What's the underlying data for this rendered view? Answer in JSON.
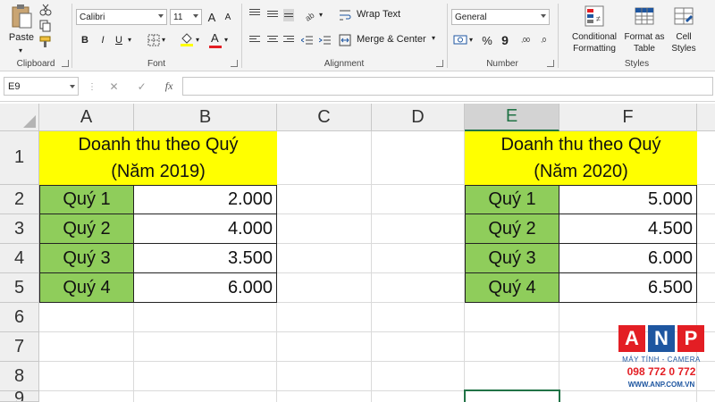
{
  "ribbon": {
    "clipboard": {
      "paste_label": "Paste",
      "group_label": "Clipboard"
    },
    "font": {
      "font_name": "Calibri",
      "font_size": "11",
      "grow_label": "A",
      "shrink_label": "A",
      "bold": "B",
      "italic": "I",
      "underline": "U",
      "font_color_label": "A",
      "group_label": "Font"
    },
    "alignment": {
      "wrap_label": "Wrap Text",
      "merge_label": "Merge & Center",
      "group_label": "Alignment"
    },
    "number": {
      "format": "General",
      "percent": "%",
      "comma": "9",
      "inc_decimal": ",00",
      "dec_decimal": ",0",
      "group_label": "Number"
    },
    "styles": {
      "cond_line1": "Conditional",
      "cond_line2": "Formatting",
      "table_line1": "Format as",
      "table_line2": "Table",
      "cell_line1": "Cell",
      "cell_line2": "Styles",
      "group_label": "Styles"
    }
  },
  "formula_bar": {
    "name_box": "E9",
    "cancel": "✕",
    "enter": "✓",
    "fx": "fx",
    "value": ""
  },
  "grid": {
    "columns": [
      "A",
      "B",
      "C",
      "D",
      "E",
      "F"
    ],
    "selected_column": "E",
    "rows": [
      "1",
      "2",
      "3",
      "4",
      "5",
      "6",
      "7",
      "8",
      "9"
    ]
  },
  "table_2019": {
    "title_line1": "Doanh thu theo Quý",
    "title_line2": "(Năm 2019)",
    "rows": [
      {
        "label": "Quý 1",
        "value": "2.000"
      },
      {
        "label": "Quý 2",
        "value": "4.000"
      },
      {
        "label": "Quý 3",
        "value": "3.500"
      },
      {
        "label": "Quý 4",
        "value": "6.000"
      }
    ]
  },
  "table_2020": {
    "title_line1": "Doanh thu theo Quý",
    "title_line2": "(Năm 2020)",
    "rows": [
      {
        "label": "Quý 1",
        "value": "5.000"
      },
      {
        "label": "Quý 2",
        "value": "4.500"
      },
      {
        "label": "Quý 3",
        "value": "6.000"
      },
      {
        "label": "Quý 4",
        "value": "6.500"
      }
    ]
  },
  "colors": {
    "title_fill": "#ffff00",
    "label_fill": "#8fcd5b",
    "excel_green": "#217346",
    "logo_red": "#e31e24",
    "logo_blue": "#1e56a0"
  },
  "logo": {
    "letters": [
      "A",
      "N",
      "P"
    ],
    "tagline": "MÁY TÍNH - CAMERA",
    "phone": "098 772 0 772",
    "site": "WWW.ANP.COM.VN"
  }
}
